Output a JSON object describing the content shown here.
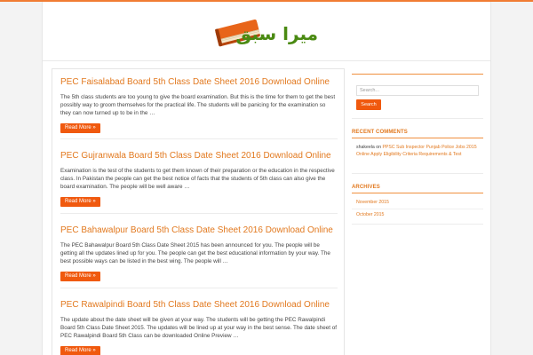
{
  "site": {
    "logo_text": "میرا سبق",
    "colors": {
      "accent": "#f17c33",
      "title": "#e2791f",
      "button": "#f0590e"
    }
  },
  "posts": [
    {
      "title": "PEC Faisalabad Board 5th Class Date Sheet 2016 Download Online",
      "excerpt": "The 5th class students are too young to give the board examination. But this is the time for them to get the best possibly way to groom themselves for the practical life. The students will be panicing for the examination so they can now turned up to be in the …",
      "more": "Read More »"
    },
    {
      "title": "PEC Gujranwala Board 5th Class Date Sheet 2016 Download Online",
      "excerpt": "Examination is the test of the students to get them known of their preparation or the education in the respective class. In Pakistan the people can get the best notice of facts that the students of 5th class can also give the board examination. The people will be well aware …",
      "more": "Read More »"
    },
    {
      "title": "PEC Bahawalpur Board 5th Class Date Sheet 2016 Download Online",
      "excerpt": "The PEC Bahawalpur Board 5th Class Date Sheet 2015 has been announced for you. The people will be getting all the updates lined up for you. The people can get the best educational information by your way. The best possible ways can be listed in the best wing. The people will …",
      "more": "Read More »"
    },
    {
      "title": "PEC Rawalpindi Board 5th Class Date Sheet 2016 Download Online",
      "excerpt": "The update about the date sheet will be given at your way. The students will be getting the PEC Rawalpindi Board 5th Class Date Sheet 2015. The updates will be lined up at your way in the best sense. The date sheet of PEC Rawalpindi Board 5th Class can be downloaded Online Preview …",
      "more": "Read More »"
    }
  ],
  "sidebar": {
    "search": {
      "placeholder": "Search...",
      "button": "Search"
    },
    "recent_comments": {
      "title": "RECENT COMMENTS",
      "author": "shakeela",
      "on": "on",
      "post": "PPSC Sub Inspector Punjab Police Jobs 2015 Online Apply Eligibility Criteria Requirements & Test"
    },
    "archives": {
      "title": "ARCHIVES",
      "items": [
        "November 2015",
        "October 2015"
      ]
    }
  }
}
